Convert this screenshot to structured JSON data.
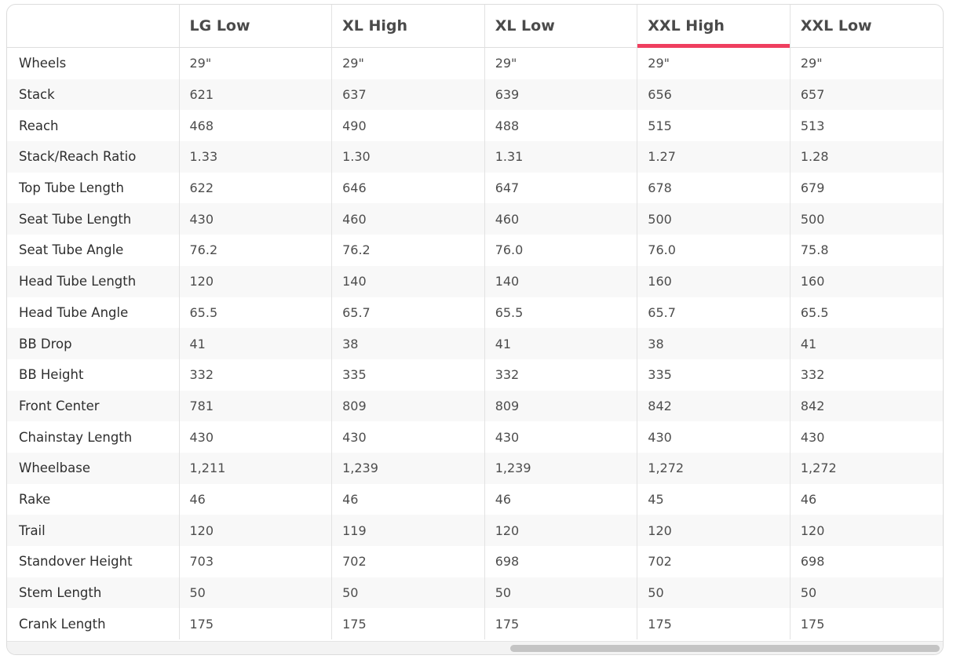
{
  "geometry_table": {
    "columns": [
      "LG Low",
      "XL High",
      "XL Low",
      "XXL High",
      "XXL Low"
    ],
    "active_column": "XXL High",
    "rows": [
      {
        "label": "Wheels",
        "values": [
          "29\"",
          "29\"",
          "29\"",
          "29\"",
          "29\""
        ]
      },
      {
        "label": "Stack",
        "values": [
          "621",
          "637",
          "639",
          "656",
          "657"
        ]
      },
      {
        "label": "Reach",
        "values": [
          "468",
          "490",
          "488",
          "515",
          "513"
        ]
      },
      {
        "label": "Stack/Reach Ratio",
        "values": [
          "1.33",
          "1.30",
          "1.31",
          "1.27",
          "1.28"
        ]
      },
      {
        "label": "Top Tube Length",
        "values": [
          "622",
          "646",
          "647",
          "678",
          "679"
        ]
      },
      {
        "label": "Seat Tube Length",
        "values": [
          "430",
          "460",
          "460",
          "500",
          "500"
        ]
      },
      {
        "label": "Seat Tube Angle",
        "values": [
          "76.2",
          "76.2",
          "76.0",
          "76.0",
          "75.8"
        ]
      },
      {
        "label": "Head Tube Length",
        "values": [
          "120",
          "140",
          "140",
          "160",
          "160"
        ]
      },
      {
        "label": "Head Tube Angle",
        "values": [
          "65.5",
          "65.7",
          "65.5",
          "65.7",
          "65.5"
        ]
      },
      {
        "label": "BB Drop",
        "values": [
          "41",
          "38",
          "41",
          "38",
          "41"
        ]
      },
      {
        "label": "BB Height",
        "values": [
          "332",
          "335",
          "332",
          "335",
          "332"
        ]
      },
      {
        "label": "Front Center",
        "values": [
          "781",
          "809",
          "809",
          "842",
          "842"
        ]
      },
      {
        "label": "Chainstay Length",
        "values": [
          "430",
          "430",
          "430",
          "430",
          "430"
        ]
      },
      {
        "label": "Wheelbase",
        "values": [
          "1,211",
          "1,239",
          "1,239",
          "1,272",
          "1,272"
        ]
      },
      {
        "label": "Rake",
        "values": [
          "46",
          "46",
          "46",
          "45",
          "46"
        ]
      },
      {
        "label": "Trail",
        "values": [
          "120",
          "119",
          "120",
          "120",
          "120"
        ]
      },
      {
        "label": "Standover Height",
        "values": [
          "703",
          "702",
          "698",
          "702",
          "698"
        ]
      },
      {
        "label": "Stem Length",
        "values": [
          "50",
          "50",
          "50",
          "50",
          "50"
        ]
      },
      {
        "label": "Crank Length",
        "values": [
          "175",
          "175",
          "175",
          "175",
          "175"
        ]
      }
    ]
  },
  "colors": {
    "active_underline": "#ef3f5f",
    "row_stripe": "#f8f8f8",
    "border": "#e2e2e2"
  }
}
